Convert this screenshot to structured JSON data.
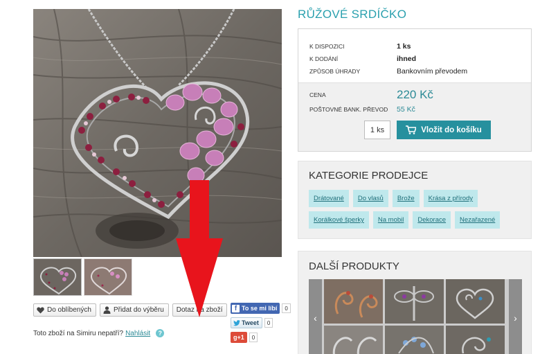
{
  "product": {
    "title": "RŮŽOVÉ SRDÍČKO",
    "availability_label": "K DISPOZICI",
    "availability_value": "1 ks",
    "delivery_label": "K DODÁNÍ",
    "delivery_value": "ihned",
    "payment_label": "ZPŮSOB ÚHRADY",
    "payment_value": "Bankovním převodem",
    "price_label": "CENA",
    "price_value": "220 Kč",
    "shipping_label": "POŠTOVNÉ BANK. PŘEVOD",
    "shipping_value": "55 Kč",
    "quantity": "1 ks",
    "add_to_cart": "Vložit do košíku"
  },
  "actions": {
    "favorite": "Do oblíbených",
    "add_selection": "Přidat do výběru",
    "question": "Dotaz na zboží"
  },
  "social": {
    "facebook_label": "To se mi líbí",
    "facebook_count": "0",
    "twitter_label": "Tweet",
    "twitter_count": "0",
    "gplus_label": "g+1",
    "gplus_count": "0"
  },
  "report": {
    "text": "Toto zboží na Simiru nepatří?",
    "link": "Nahlásit"
  },
  "categories": {
    "heading": "KATEGORIE PRODEJCE",
    "items": [
      "Drátované",
      "Do vlasů",
      "Brože",
      "Krása z přírody",
      "Korálkové šperky",
      "Na mobil",
      "Dekorace",
      "Nezařazené"
    ]
  },
  "more_products": {
    "heading": "DALŠÍ PRODUKTY"
  },
  "colors": {
    "accent": "#2aa0ae",
    "button": "#26909e",
    "tag_bg": "#bfe8ec",
    "annotation_arrow": "#e8141c"
  }
}
